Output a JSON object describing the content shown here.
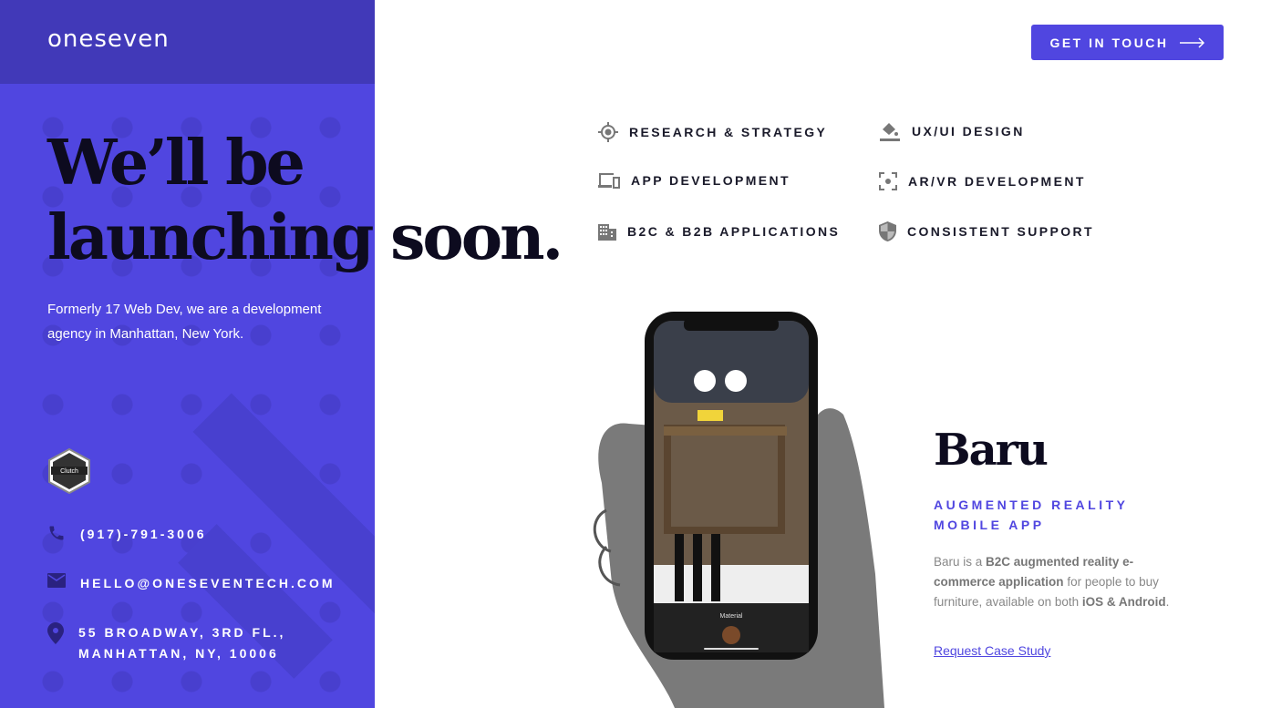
{
  "brand": {
    "logo": "oneseven"
  },
  "header": {
    "cta_label": "GET IN TOUCH"
  },
  "hero": {
    "line1": "We’ll be",
    "line2": "launching soon.",
    "intro": "Formerly 17 Web Dev, we are a development agency in Manhattan, New York."
  },
  "badge": {
    "text": "Clutch"
  },
  "contact": {
    "phone": "(917)-791-3006",
    "email": "HELLO@ONESEVENTECH.COM",
    "address_line1": "55 BROADWAY, 3RD FL.,",
    "address_line2": "MANHATTAN, NY, 10006"
  },
  "services": [
    {
      "label": "RESEARCH & STRATEGY",
      "icon": "target-icon"
    },
    {
      "label": "UX/UI DESIGN",
      "icon": "paint-bucket-icon"
    },
    {
      "label": "APP DEVELOPMENT",
      "icon": "devices-icon"
    },
    {
      "label": "AR/VR DEVELOPMENT",
      "icon": "focus-icon"
    },
    {
      "label": "B2C & B2B APPLICATIONS",
      "icon": "building-icon"
    },
    {
      "label": "CONSISTENT SUPPORT",
      "icon": "shield-icon"
    }
  ],
  "project": {
    "title": "Baru",
    "subtitle1": "AUGMENTED REALITY",
    "subtitle2": "MOBILE APP",
    "desc_1": "Baru is a ",
    "desc_2": "B2C augmented reality e-commerce application",
    "desc_3": " for people to buy furniture, available on both ",
    "desc_4": "iOS & Android",
    "desc_5": ".",
    "link": "Request Case Study",
    "phone_label": "Material"
  },
  "colors": {
    "accent": "#5046e0",
    "header": "#4139b8"
  }
}
